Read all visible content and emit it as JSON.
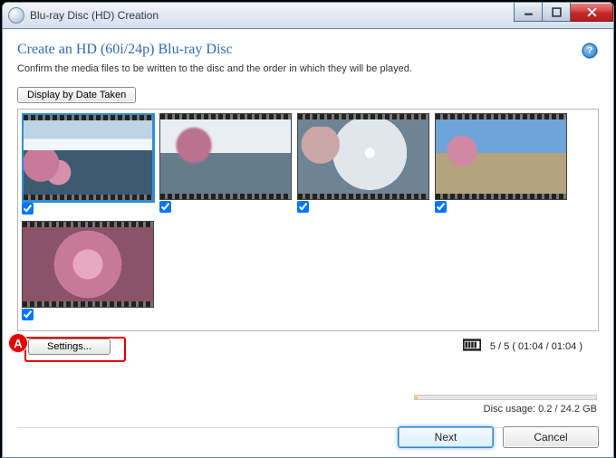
{
  "window": {
    "title": "Blu-ray Disc (HD) Creation"
  },
  "page": {
    "heading": "Create an HD (60i/24p) Blu-ray Disc",
    "instruction": "Confirm the media files to be written to the disc and the order in which they will be played."
  },
  "buttons": {
    "display_by_date": "Display by Date Taken",
    "settings": "Settings...",
    "next": "Next",
    "cancel": "Cancel"
  },
  "thumbnails": [
    {
      "checked": true,
      "selected": true,
      "kind": "lake1"
    },
    {
      "checked": true,
      "selected": false,
      "kind": "lake2"
    },
    {
      "checked": true,
      "selected": false,
      "kind": "lake3"
    },
    {
      "checked": true,
      "selected": false,
      "kind": "park"
    },
    {
      "checked": true,
      "selected": false,
      "kind": "blossom"
    }
  ],
  "status": {
    "count_text": "5 / 5 ( 01:04 / 01:04 )",
    "usage_text": "Disc usage: 0.2 / 24.2 GB"
  },
  "annotation": {
    "marker": "A"
  }
}
